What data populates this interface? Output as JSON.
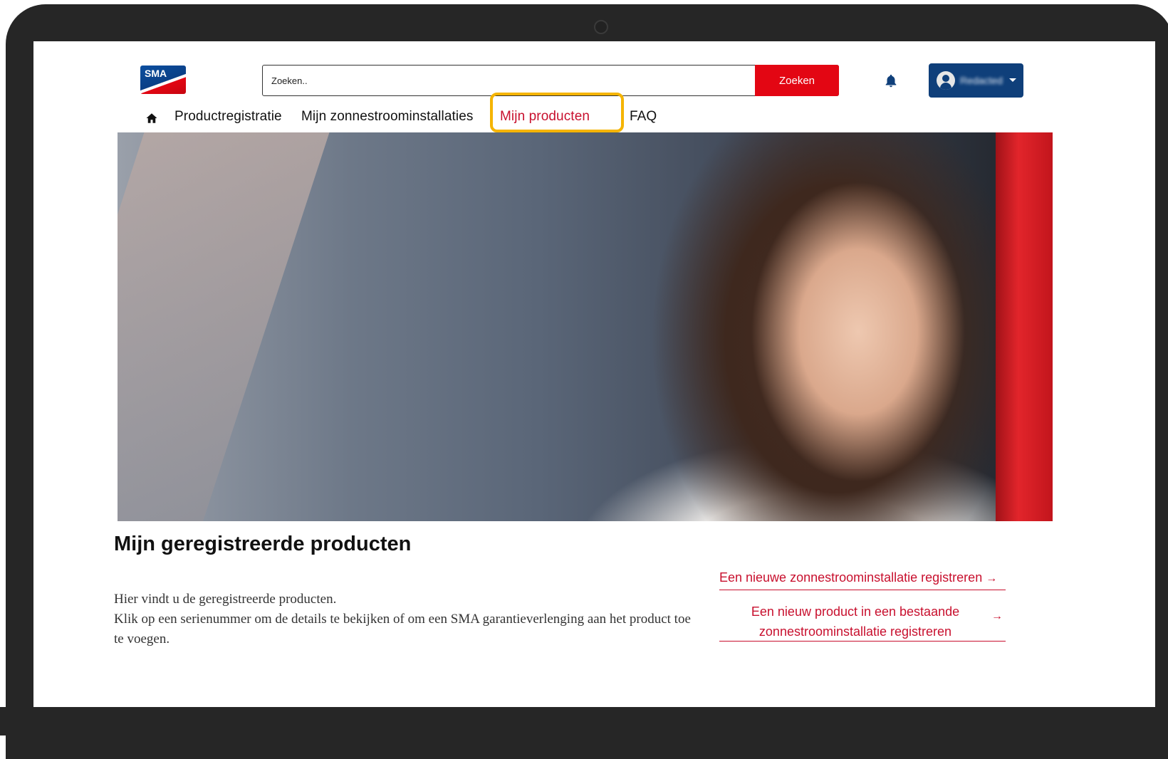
{
  "logo": {
    "text": "SMA"
  },
  "search": {
    "placeholder": "Zoeken..",
    "button_label": "Zoeken"
  },
  "user": {
    "name": "Redacted"
  },
  "nav": {
    "items": [
      {
        "label": "Productregistratie"
      },
      {
        "label": "Mijn zonnestroominstallaties"
      },
      {
        "label": "Mijn producten",
        "active": true
      },
      {
        "label": "FAQ"
      }
    ]
  },
  "main": {
    "title": "Mijn geregistreerde producten",
    "description_line1": "Hier vindt u de geregistreerde producten.",
    "description_line2": "Klik op een serienummer om de details te bekijken of om een SMA garantieverlenging aan het product toe te voegen.",
    "links": [
      {
        "label": "Een nieuwe zonnestroominstallatie registreren",
        "arrow": "→"
      },
      {
        "label": "Een nieuw product in een bestaande zonnestroominstallatie registreren",
        "arrow": "→"
      }
    ]
  },
  "colors": {
    "accent": "#c8102e",
    "highlight": "#f5b400",
    "user_button": "#0f3f7a",
    "bezel": "#262626"
  },
  "icons": [
    "home-icon",
    "bell-icon",
    "avatar-icon",
    "caret-down-icon",
    "arrow-right-icon"
  ]
}
